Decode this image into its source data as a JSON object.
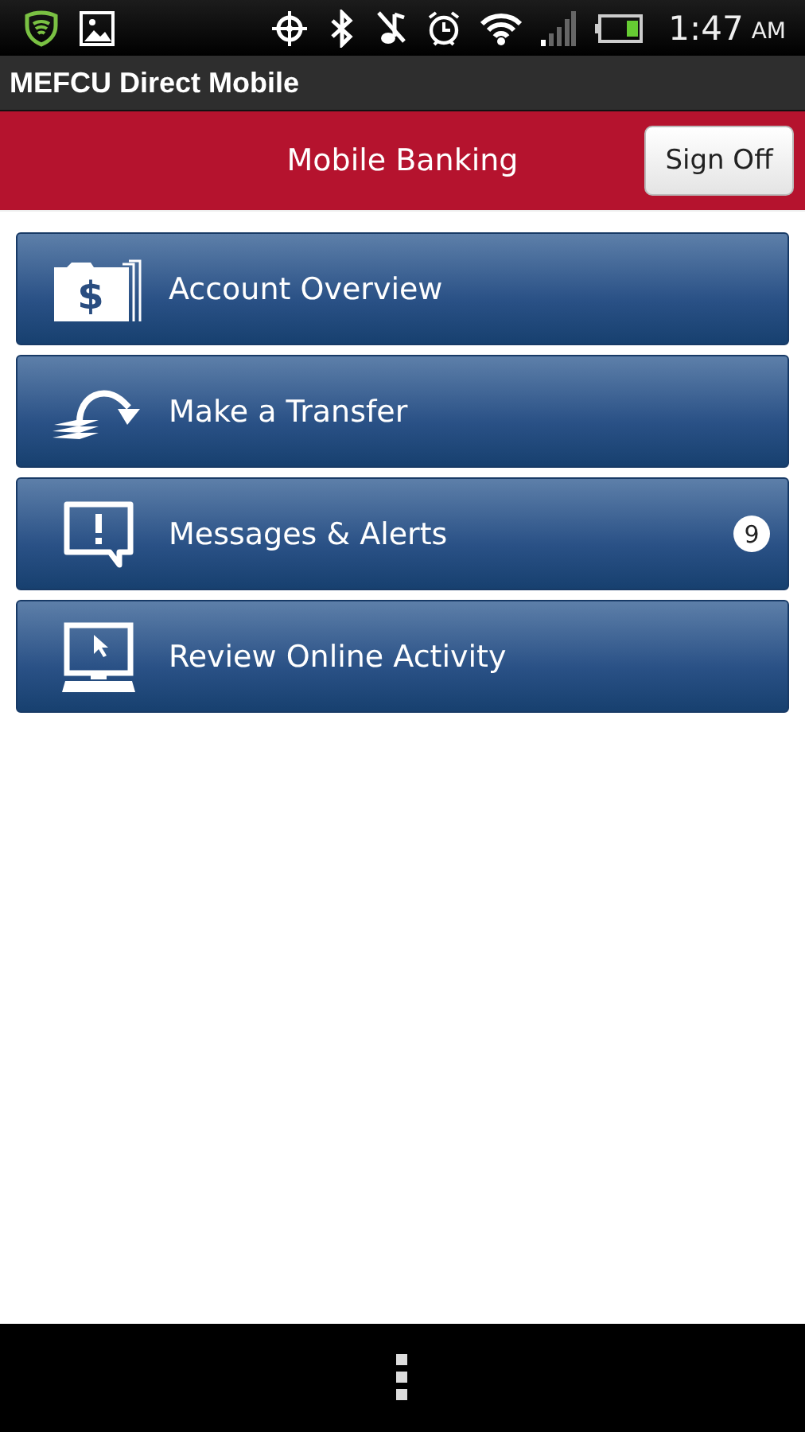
{
  "status_bar": {
    "time": "1:47",
    "meridiem": "AM"
  },
  "app_bar": {
    "title": "MEFCU Direct Mobile"
  },
  "header": {
    "title": "Mobile Banking",
    "button": "Sign Off"
  },
  "menu": [
    {
      "label": "Account Overview",
      "kind": "folder",
      "icon_text": "$"
    },
    {
      "label": "Make a Transfer",
      "kind": "transfer"
    },
    {
      "label": "Messages & Alerts",
      "kind": "message",
      "badge": "9"
    },
    {
      "label": "Review Online Activity",
      "kind": "monitor"
    }
  ]
}
